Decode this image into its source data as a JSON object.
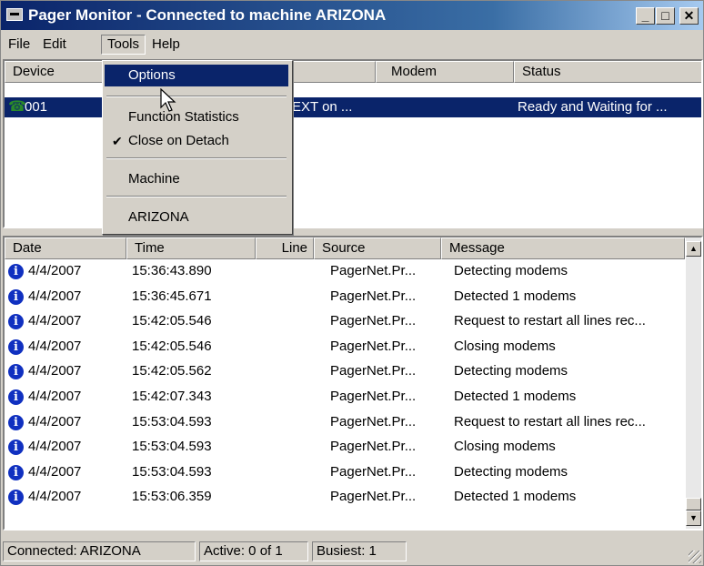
{
  "window": {
    "title": "Pager Monitor - Connected to machine ARIZONA"
  },
  "menubar": {
    "items": [
      "File",
      "Edit",
      "Tools",
      "Help"
    ]
  },
  "tools_menu": {
    "items": [
      "Options",
      "Function Statistics",
      "Close on Detach",
      "Machine",
      "ARIZONA"
    ],
    "checked": "Close on Detach"
  },
  "devices": {
    "columns": [
      "Device",
      "Modem",
      "Status"
    ],
    "rows": [
      {
        "device": "001",
        "partial": "EXT on ...",
        "status": "Ready and Waiting for ..."
      }
    ]
  },
  "log": {
    "columns": [
      "Date",
      "Time",
      "Line",
      "Source",
      "Message"
    ],
    "rows": [
      {
        "date": "4/4/2007",
        "time": "15:36:43.890",
        "line": "",
        "source": "PagerNet.Pr...",
        "message": "Detecting modems"
      },
      {
        "date": "4/4/2007",
        "time": "15:36:45.671",
        "line": "",
        "source": "PagerNet.Pr...",
        "message": "Detected 1  modems"
      },
      {
        "date": "4/4/2007",
        "time": "15:42:05.546",
        "line": "",
        "source": "PagerNet.Pr...",
        "message": "Request to restart all lines rec..."
      },
      {
        "date": "4/4/2007",
        "time": "15:42:05.546",
        "line": "",
        "source": "PagerNet.Pr...",
        "message": "Closing modems"
      },
      {
        "date": "4/4/2007",
        "time": "15:42:05.562",
        "line": "",
        "source": "PagerNet.Pr...",
        "message": "Detecting modems"
      },
      {
        "date": "4/4/2007",
        "time": "15:42:07.343",
        "line": "",
        "source": "PagerNet.Pr...",
        "message": "Detected 1  modems"
      },
      {
        "date": "4/4/2007",
        "time": "15:53:04.593",
        "line": "",
        "source": "PagerNet.Pr...",
        "message": "Request to restart all lines rec..."
      },
      {
        "date": "4/4/2007",
        "time": "15:53:04.593",
        "line": "",
        "source": "PagerNet.Pr...",
        "message": "Closing modems"
      },
      {
        "date": "4/4/2007",
        "time": "15:53:04.593",
        "line": "",
        "source": "PagerNet.Pr...",
        "message": "Detecting modems"
      },
      {
        "date": "4/4/2007",
        "time": "15:53:06.359",
        "line": "",
        "source": "PagerNet.Pr...",
        "message": "Detected 1  modems"
      }
    ]
  },
  "statusbar": {
    "connected": "Connected: ARIZONA",
    "active": "Active: 0 of 1",
    "busiest": "Busiest: 1"
  },
  "icons": {
    "title": "pager-app-icon",
    "device": "phone-icon",
    "log": "info-icon"
  }
}
